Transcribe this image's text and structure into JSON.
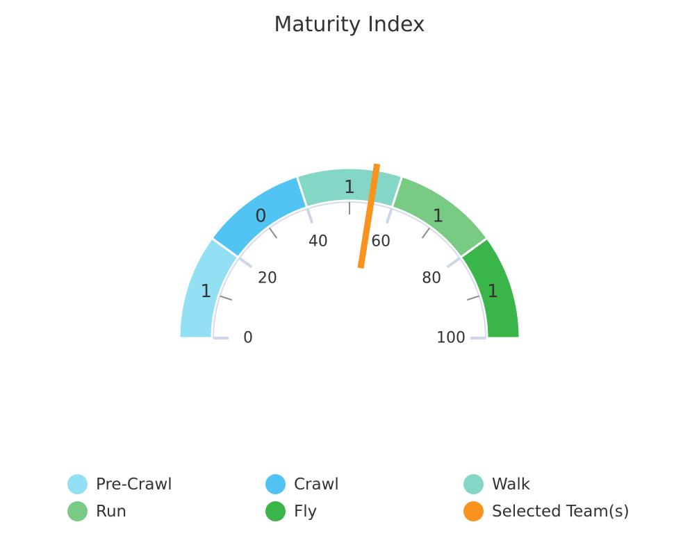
{
  "chart_data": {
    "type": "gauge",
    "title": "Maturity Index",
    "scale": {
      "min": 0,
      "max": 100,
      "major_ticks": [
        0,
        20,
        40,
        60,
        80,
        100
      ],
      "minor_tick_step": 10
    },
    "bands": [
      {
        "name": "Pre-Crawl",
        "from": 0,
        "to": 20,
        "label": "1",
        "color": "#93DFF3"
      },
      {
        "name": "Crawl",
        "from": 20,
        "to": 40,
        "label": "0",
        "color": "#52C4F3"
      },
      {
        "name": "Walk",
        "from": 40,
        "to": 60,
        "label": "1",
        "color": "#84D6C7"
      },
      {
        "name": "Run",
        "from": 60,
        "to": 80,
        "label": "1",
        "color": "#79CB84"
      },
      {
        "name": "Fly",
        "from": 80,
        "to": 100,
        "label": "1",
        "color": "#39B54A"
      }
    ],
    "needle": {
      "name": "Selected Team(s)",
      "value": 55,
      "color": "#F7931E"
    },
    "legend": {
      "placement": "bottom",
      "items": [
        {
          "name": "Pre-Crawl",
          "color": "#93DFF3"
        },
        {
          "name": "Crawl",
          "color": "#52C4F3"
        },
        {
          "name": "Walk",
          "color": "#84D6C7"
        },
        {
          "name": "Run",
          "color": "#79CB84"
        },
        {
          "name": "Fly",
          "color": "#39B54A"
        },
        {
          "name": "Selected Team(s)",
          "color": "#F7931E"
        }
      ]
    }
  }
}
